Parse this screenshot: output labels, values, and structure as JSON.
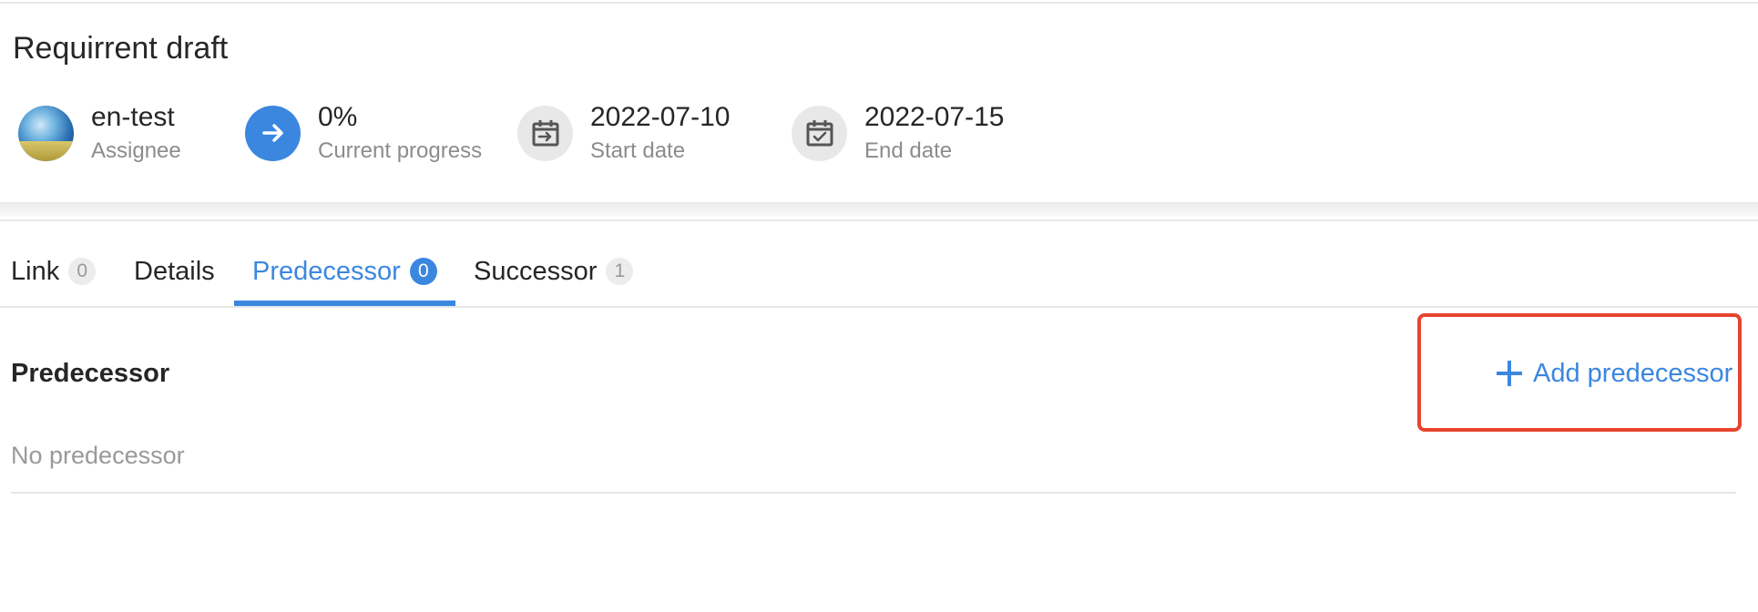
{
  "task": {
    "title": "Requirrent draft"
  },
  "meta": {
    "assignee": {
      "value": "en-test",
      "label": "Assignee",
      "icon": "avatar-image"
    },
    "progress": {
      "value": "0%",
      "label": "Current progress",
      "icon": "arrow-right-icon"
    },
    "start": {
      "value": "2022-07-10",
      "label": "Start date",
      "icon": "calendar-start-icon"
    },
    "end": {
      "value": "2022-07-15",
      "label": "End date",
      "icon": "calendar-check-icon"
    }
  },
  "tabs": [
    {
      "label": "Link",
      "count": "0",
      "active": false
    },
    {
      "label": "Details",
      "count": null,
      "active": false
    },
    {
      "label": "Predecessor",
      "count": "0",
      "active": true
    },
    {
      "label": "Successor",
      "count": "1",
      "active": false
    }
  ],
  "predecessor": {
    "title": "Predecessor",
    "add_label": "Add predecessor",
    "empty_text": "No predecessor"
  },
  "colors": {
    "accent": "#3b87e0",
    "highlight": "#e8432e",
    "muted_text": "#8c8c8c"
  }
}
